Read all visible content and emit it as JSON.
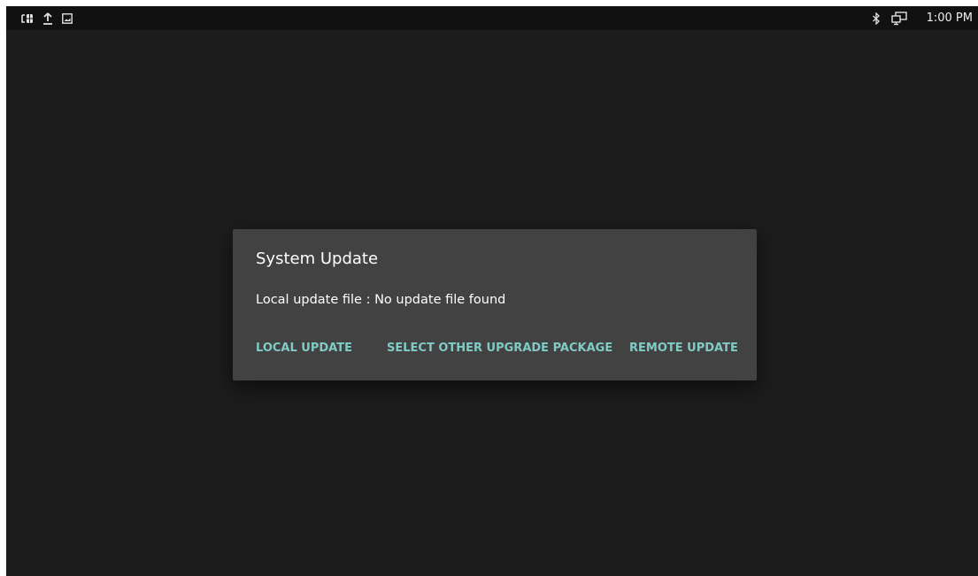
{
  "status_bar": {
    "left_icons": [
      "usb-debug-icon",
      "upload-icon",
      "image-icon"
    ],
    "right_icons": [
      "bluetooth-icon",
      "screen-cast-icon"
    ],
    "time": "1:00 PM"
  },
  "dialog": {
    "title": "System Update",
    "message": "Local update file : No update file found",
    "buttons": {
      "local_update": "LOCAL UPDATE",
      "select_other": "SELECT OTHER UPGRADE PACKAGE",
      "remote_update": "REMOTE UPDATE"
    }
  },
  "colors": {
    "background": "#1c1c1c",
    "status_bar": "#111111",
    "dialog": "#424242",
    "accent": "#80cbc4"
  }
}
